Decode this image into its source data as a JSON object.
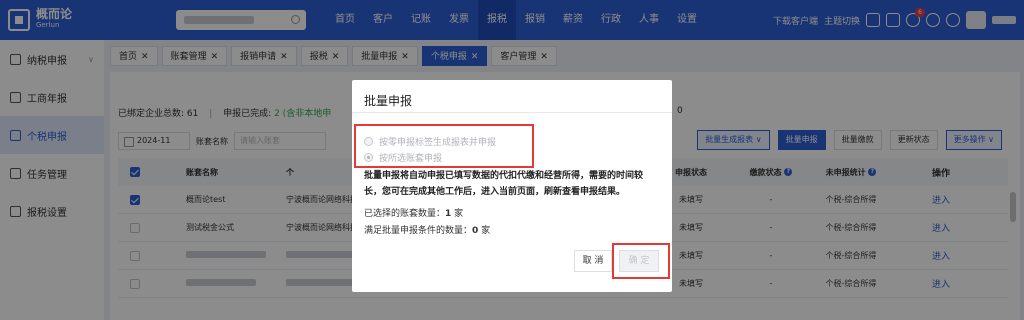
{
  "app": {
    "logo_name": "概而论",
    "logo_sub": "Gerlun"
  },
  "nav": [
    "首页",
    "客户",
    "记账",
    "发票",
    "报税",
    "报销",
    "薪资",
    "行政",
    "人事",
    "设置"
  ],
  "nav_active_index": 4,
  "top_right": {
    "download": "下载客户端",
    "theme": "主题切换",
    "badge": "6"
  },
  "sidebar": [
    {
      "label": "纳税申报",
      "icon": "tax-icon",
      "chevron": "∨"
    },
    {
      "label": "工商年报",
      "icon": "report-icon"
    },
    {
      "label": "个税申报",
      "icon": "personal-tax-icon",
      "active": true
    },
    {
      "label": "任务管理",
      "icon": "task-icon"
    },
    {
      "label": "报税设置",
      "icon": "gear-icon"
    }
  ],
  "tabs": [
    {
      "label": "首页"
    },
    {
      "label": "账套管理"
    },
    {
      "label": "报销申请"
    },
    {
      "label": "报税"
    },
    {
      "label": "批量申报"
    },
    {
      "label": "个税申报",
      "active": true
    },
    {
      "label": "客户管理"
    }
  ],
  "summary": {
    "bound_label": "已绑定企业总数:",
    "bound_count": "61",
    "done_label": "申报已完成:",
    "done_count": "2 (含非本地申",
    "right_count": "0"
  },
  "filter": {
    "date": "2024-11",
    "name_label": "账套名称",
    "name_placeholder": "请输入账套"
  },
  "buttons": {
    "batch_generate": "批量生成报表 ∨",
    "batch_declare": "批量申报",
    "batch_pay": "批量缴款",
    "update_status": "更新状态",
    "more_ops": "更多操作 ∨"
  },
  "table": {
    "headers": {
      "name": "账套名称",
      "company": "个",
      "declare_status": "申报状态",
      "pay_status": "缴款状态",
      "unfiled_stats": "未申报统计",
      "op": "操作"
    },
    "rows": [
      {
        "name": "概而论test",
        "company": "宁波概而论网络科技",
        "declare_status": "未填写",
        "pay_status": "-",
        "unfiled_stats": "个税-综合所得",
        "op": "进入",
        "checked": true
      },
      {
        "name": "测试税金公式",
        "company": "宁波概而论网络科技",
        "declare_status": "未填写",
        "pay_status": "-",
        "unfiled_stats": "个税-综合所得",
        "op": "进入",
        "checked": false
      },
      {
        "name": "",
        "company": "",
        "declare_status": "未填写",
        "pay_status": "-",
        "unfiled_stats": "个税-综合所得",
        "op": "进入",
        "checked": false
      },
      {
        "name": "",
        "company": "",
        "declare_status": "未填写",
        "pay_status": "-",
        "unfiled_stats": "个税-综合所得",
        "op": "进入",
        "checked": false
      }
    ]
  },
  "modal": {
    "title": "批量申报",
    "option1": "按零申报标签生成报表并申报",
    "option2": "按所选账套申报",
    "description": "批量申报将自动申报已填写数据的代扣代缴和经营所得，需要的时间较长，您可在完成其他工作后，进入当前页面，刷新查看申报结果。",
    "selected_label": "已选择的账套数量：",
    "selected_count": "1",
    "selected_unit": " 家",
    "eligible_label": "满足批量申报条件的数量：",
    "eligible_count": "0",
    "eligible_unit": " 家",
    "cancel": "取 消",
    "confirm": "确 定"
  }
}
